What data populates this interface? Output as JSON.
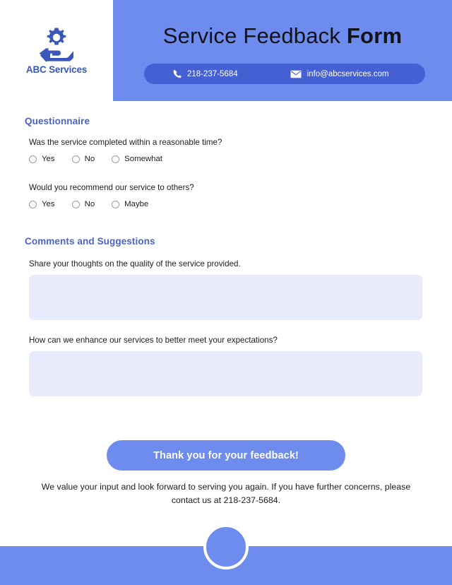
{
  "header": {
    "brand_name": "ABC Services",
    "logo_icon": "gear-in-hand-icon",
    "title_light": "Service Feedback",
    "title_bold": "Form",
    "contact": {
      "phone_icon": "phone-icon",
      "phone": "218-237-5684",
      "email_icon": "envelope-icon",
      "email": "info@abcservices.com"
    }
  },
  "questionnaire": {
    "heading": "Questionnaire",
    "questions": [
      {
        "text": "Was the service completed within a reasonable time?",
        "options": [
          "Yes",
          "No",
          "Somewhat"
        ]
      },
      {
        "text": "Would you recommend our service to others?",
        "options": [
          "Yes",
          "No",
          "Maybe"
        ]
      }
    ]
  },
  "comments": {
    "heading": "Comments and Suggestions",
    "fields": [
      {
        "label": "Share your thoughts on the quality of the service provided.",
        "value": "",
        "placeholder": ""
      },
      {
        "label": "How can we enhance our services to better meet your expectations?",
        "value": "",
        "placeholder": ""
      }
    ]
  },
  "footer": {
    "cta_label": "Thank you for your feedback!",
    "closing_note": "We value your input and look forward to serving you again. If you have further concerns, please contact us at 218-237-5684."
  },
  "colors": {
    "brand_blue": "#6e8bee",
    "deep_blue": "#4560d2",
    "heading_blue": "#4a64c8",
    "logo_blue": "#3a57ba",
    "field_fill": "#e8ebfb",
    "text_dark": "#1b1d22"
  }
}
